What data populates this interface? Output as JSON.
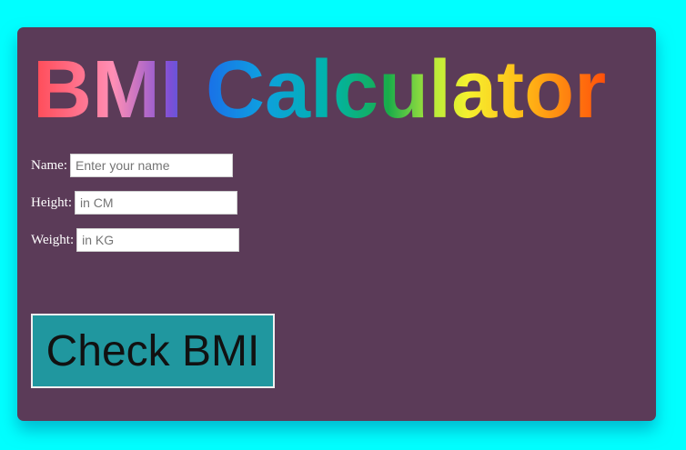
{
  "app": {
    "title": "BMI Calculator"
  },
  "form": {
    "name": {
      "label": "Name:",
      "placeholder": "Enter your name",
      "value": ""
    },
    "height": {
      "label": "Height:",
      "placeholder": "in CM",
      "value": ""
    },
    "weight": {
      "label": "Weight:",
      "placeholder": "in KG",
      "value": ""
    },
    "submit_label": "Check BMI"
  },
  "colors": {
    "page_background": "#00ffff",
    "card_background": "#5b3b58",
    "button_background": "#20979f",
    "label_text": "#ffffff",
    "title_gradient": [
      "#ff4a55",
      "#ff8fb5",
      "#7d4fd6",
      "#1a6ee8",
      "#0e9fe0",
      "#00b4a8",
      "#19ad4a",
      "#b9ec3a",
      "#f6f02e",
      "#ffb816",
      "#ff4f0a"
    ]
  }
}
